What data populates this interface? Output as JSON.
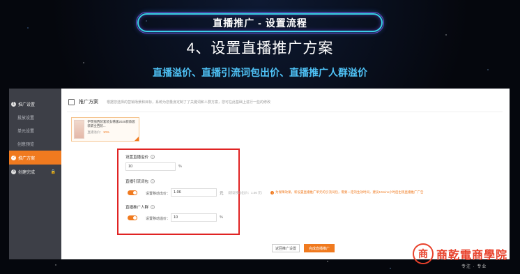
{
  "banner": {
    "title": "直播推广 - 设置流程",
    "step_title": "4、设置直播推广方案",
    "subtitle": "直播溢价、直播引流词包出价、直播推广人群溢价"
  },
  "sidebar": {
    "items": [
      {
        "label": "推广设置",
        "badge": "1",
        "type": "group"
      },
      {
        "label": "投放设置",
        "type": "item"
      },
      {
        "label": "单元设置",
        "type": "item"
      },
      {
        "label": "创意预览",
        "type": "item"
      },
      {
        "label": "推广方案",
        "badge": "2",
        "type": "group",
        "active": true
      },
      {
        "label": "创建完成",
        "badge": "3",
        "type": "group"
      }
    ]
  },
  "content": {
    "section_title": "推广方案",
    "section_desc": "根据您选择的营销场景和目标，系统为您量身定制了了关键词和人群方案，您可在此基础上进行一些的修改",
    "product": {
      "name": "伊芙丽西装套装女韩版2020新款套装职业西装...",
      "bid_label": "直播溢价：",
      "bid_value": "10%"
    },
    "live_premium": {
      "label": "设置直播溢价",
      "value": "10",
      "unit": "%"
    },
    "keyword_pack": {
      "label": "直播引流词包",
      "bid_label": "设置移动出价：",
      "value": "1.06",
      "unit": "元",
      "hint": "（建议移动出价：1.06 元）",
      "warning": "为保障效果，新设置直播推广单元的引流词包，需要一定的生效时间，建议10mins小时后出现直播推广广告"
    },
    "crowd": {
      "label": "直播推广人群",
      "bid_label": "设置移动溢价：",
      "value": "10",
      "unit": "%"
    },
    "buttons": {
      "prev": "返回推广设置",
      "done": "完成直播推广"
    }
  },
  "logo": {
    "mark": "商",
    "text": "商乾電商學院",
    "sub": "专注 · 专业"
  },
  "colors": {
    "accent": "#f07a1f",
    "highlight_box": "#e02323",
    "subtitle": "#4fc3f7",
    "logo": "#e8412b"
  }
}
